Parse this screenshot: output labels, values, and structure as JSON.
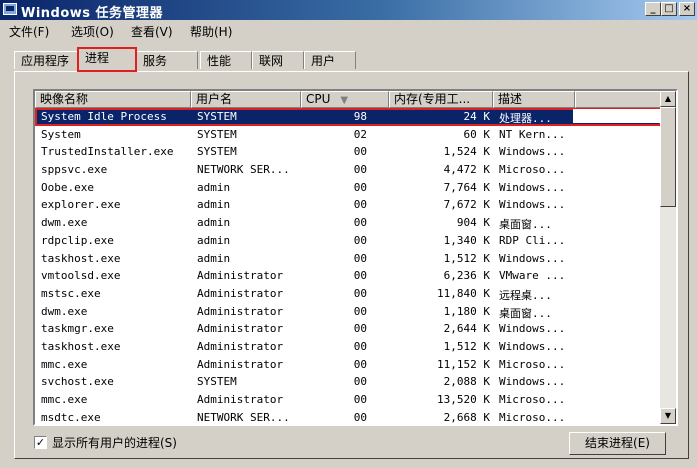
{
  "window": {
    "title": "Windows 任务管理器"
  },
  "menu": [
    "文件(F)",
    "选项(O)",
    "查看(V)",
    "帮助(H)"
  ],
  "tabs": [
    {
      "label": "应用程序"
    },
    {
      "label": "进程",
      "active": true
    },
    {
      "label": "服务"
    },
    {
      "label": "性能"
    },
    {
      "label": "联网"
    },
    {
      "label": "用户"
    }
  ],
  "columns": [
    "映像名称",
    "用户名",
    "CPU",
    "内存(专用工...",
    "描述"
  ],
  "processes": [
    {
      "name": "System Idle Process",
      "user": "SYSTEM",
      "cpu": "98",
      "mem": "24 K",
      "desc": "处理器...",
      "selected": true
    },
    {
      "name": "System",
      "user": "SYSTEM",
      "cpu": "02",
      "mem": "60 K",
      "desc": "NT Kern..."
    },
    {
      "name": "TrustedInstaller.exe",
      "user": "SYSTEM",
      "cpu": "00",
      "mem": "1,524 K",
      "desc": "Windows..."
    },
    {
      "name": "sppsvc.exe",
      "user": "NETWORK SER...",
      "cpu": "00",
      "mem": "4,472 K",
      "desc": "Microso..."
    },
    {
      "name": "Oobe.exe",
      "user": "admin",
      "cpu": "00",
      "mem": "7,764 K",
      "desc": "Windows..."
    },
    {
      "name": "explorer.exe",
      "user": "admin",
      "cpu": "00",
      "mem": "7,672 K",
      "desc": "Windows..."
    },
    {
      "name": "dwm.exe",
      "user": "admin",
      "cpu": "00",
      "mem": "904 K",
      "desc": "桌面窗..."
    },
    {
      "name": "rdpclip.exe",
      "user": "admin",
      "cpu": "00",
      "mem": "1,340 K",
      "desc": "RDP Cli..."
    },
    {
      "name": "taskhost.exe",
      "user": "admin",
      "cpu": "00",
      "mem": "1,512 K",
      "desc": "Windows..."
    },
    {
      "name": "vmtoolsd.exe",
      "user": "Administrator",
      "cpu": "00",
      "mem": "6,236 K",
      "desc": "VMware ..."
    },
    {
      "name": "mstsc.exe",
      "user": "Administrator",
      "cpu": "00",
      "mem": "11,840 K",
      "desc": "远程桌..."
    },
    {
      "name": "dwm.exe",
      "user": "Administrator",
      "cpu": "00",
      "mem": "1,180 K",
      "desc": "桌面窗..."
    },
    {
      "name": "taskmgr.exe",
      "user": "Administrator",
      "cpu": "00",
      "mem": "2,644 K",
      "desc": "Windows..."
    },
    {
      "name": "taskhost.exe",
      "user": "Administrator",
      "cpu": "00",
      "mem": "1,512 K",
      "desc": "Windows..."
    },
    {
      "name": "mmc.exe",
      "user": "Administrator",
      "cpu": "00",
      "mem": "11,152 K",
      "desc": "Microso..."
    },
    {
      "name": "svchost.exe",
      "user": "SYSTEM",
      "cpu": "00",
      "mem": "2,088 K",
      "desc": "Windows..."
    },
    {
      "name": "mmc.exe",
      "user": "Administrator",
      "cpu": "00",
      "mem": "13,520 K",
      "desc": "Microso..."
    },
    {
      "name": "msdtc.exe",
      "user": "NETWORK SER...",
      "cpu": "00",
      "mem": "2,668 K",
      "desc": "Microso..."
    }
  ],
  "footer": {
    "show_all_label": "显示所有用户的进程(S)",
    "show_all_checked": true,
    "end_process_label": "结束进程(E)"
  },
  "icons": {
    "app": "task-manager-icon",
    "minimize": "minimize-icon",
    "maximize": "maximize-icon",
    "close": "close-icon",
    "sort": "sort-desc-icon",
    "scroll_up": "scroll-up-icon",
    "scroll_down": "scroll-down-icon"
  },
  "colors": {
    "titlebar": "#0a246a",
    "selection": "#0a246a",
    "highlight_box": "#e02020",
    "face": "#d4d0c8"
  }
}
